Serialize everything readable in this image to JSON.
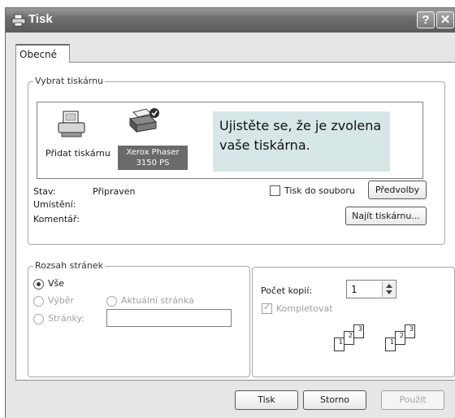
{
  "window": {
    "title": "Tisk",
    "help_label": "?",
    "close_label": "✕"
  },
  "tabs": [
    {
      "label": "Obecné",
      "active": true
    }
  ],
  "select_printer": {
    "legend": "Vybrat tiskárnu",
    "add_printer_label": "Přidat tiskárnu",
    "selected_printer_label": "Xerox Phaser 3150 PS",
    "callout_text": "Ujistěte se, že je zvolena vaše tiskárna.",
    "status_label": "Stav:",
    "status_value": "Připraven",
    "location_label": "Umístění:",
    "comment_label": "Komentář:",
    "print_to_file_label": "Tisk do souboru",
    "print_to_file_checked": false,
    "preferences_button": "Předvolby",
    "find_printer_button": "Najít tiskárnu..."
  },
  "page_range": {
    "legend": "Rozsah stránek",
    "all_label": "Vše",
    "selection_label": "Výběr",
    "current_page_label": "Aktuální stránka",
    "pages_label": "Stránky:",
    "pages_value": "",
    "selected": "Vše"
  },
  "copies": {
    "count_label": "Počet kopií:",
    "count_value": "1",
    "collate_label": "Kompletovat",
    "collate_checked": true,
    "collate_icon_pages": [
      "1",
      "2",
      "3"
    ]
  },
  "footer": {
    "print_button": "Tisk",
    "cancel_button": "Storno",
    "apply_button": "Použít"
  },
  "icons": [
    "printer-dialog-icon",
    "help-icon",
    "close-icon",
    "add-printer-icon",
    "default-printer-icon",
    "collate-pages-icon",
    "spinner-arrows-icon"
  ],
  "colors": {
    "title_bar": "#6f6f6f",
    "callout_bg": "#d7e7e7",
    "selected_printer_bg": "#6a6a6a",
    "dialog_bg": "#e6e6e6"
  }
}
